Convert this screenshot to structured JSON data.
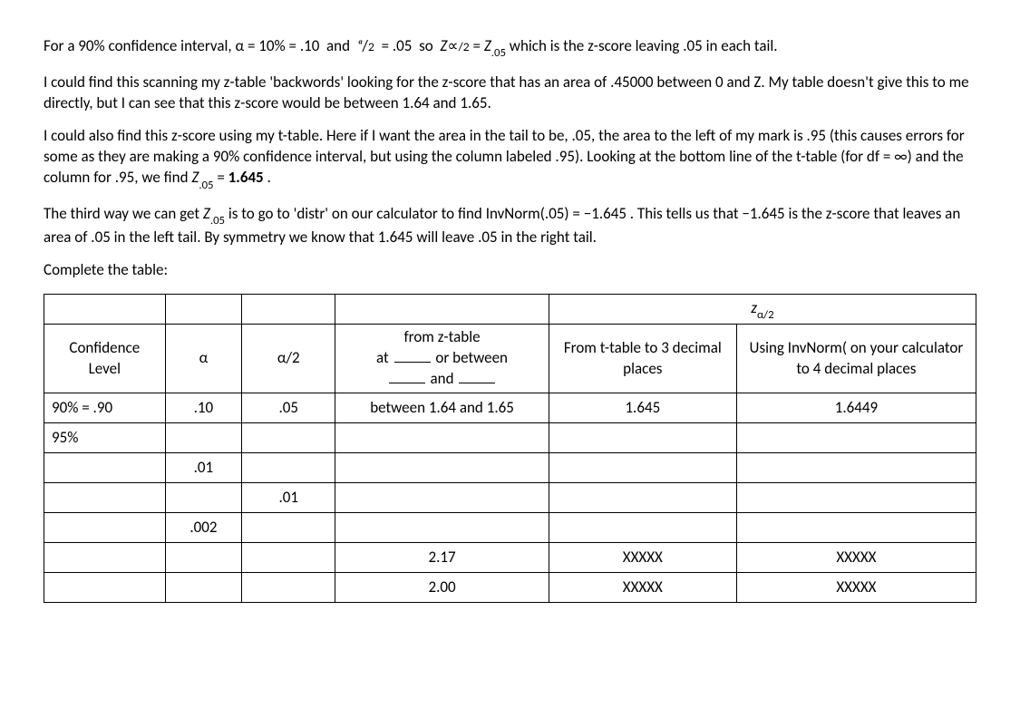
{
  "para1_pre": "For a 90% confidence interval, ",
  "para1_expr": "α = 10% = .10  and  ᵅ/₂  = .05  so   Z∝/₂ = Z.05",
  "para1_post": "  which is the z-score leaving .05 in each tail.",
  "para2": "I could find this scanning my z-table 'backwords' looking for the z-score that has an area of .45000 between 0 and Z.  My table doesn't give this to me directly, but I can see that this z-score would be between 1.64 and 1.65.",
  "para3_a": "I could also find this z-score using my t-table.  Here if I want the area in the tail to be, .05, the area to the left of my mark is .95 (this causes errors for some as they are making a 90% confidence interval, but using the column labeled .95).  Looking at the bottom line of the t-table (for df = ∞) and the column for .95, we find ",
  "para3_z": "Z.05",
  "para3_eq": " = ",
  "para3_val": "1.645",
  "para3_end": " .",
  "para4_a": "The third way we can get ",
  "para4_z": "Z.05",
  "para4_b": " is to go to 'distr' on our calculator to find InvNorm(.05) = −1.645 .  This tells us that −1.645 is the z-score that leaves an area of .05 in the left tail.  By symmetry we know that 1.645 will leave .05 in the right tail.",
  "para5": "Complete the table:",
  "table": {
    "zheader": "zα/2",
    "h_conf": "Confidence Level",
    "h_alpha": "α",
    "h_alpha2": "α/2",
    "h_ztable_a": "from z-table",
    "h_ztable_b1": "at ",
    "h_ztable_b2": " or between ",
    "h_ztable_c": " and ",
    "h_ttable": "From t-table to 3 decimal places",
    "h_inv": "Using InvNorm(   on your calculator to 4 decimal places",
    "r1_conf": "90% = .90",
    "r1_a": ".10",
    "r1_a2": ".05",
    "r1_zt": "between 1.64  and 1.65",
    "r1_tt": "1.645",
    "r1_in": "1.6449",
    "r2_conf": "95%",
    "r3_a": ".01",
    "r4_a2": ".01",
    "r5_a": ".002",
    "r6_zt": "2.17",
    "r6_tt": "XXXXX",
    "r6_in": "XXXXX",
    "r7_zt": "2.00",
    "r7_tt": "XXXXX",
    "r7_in": "XXXXX"
  }
}
